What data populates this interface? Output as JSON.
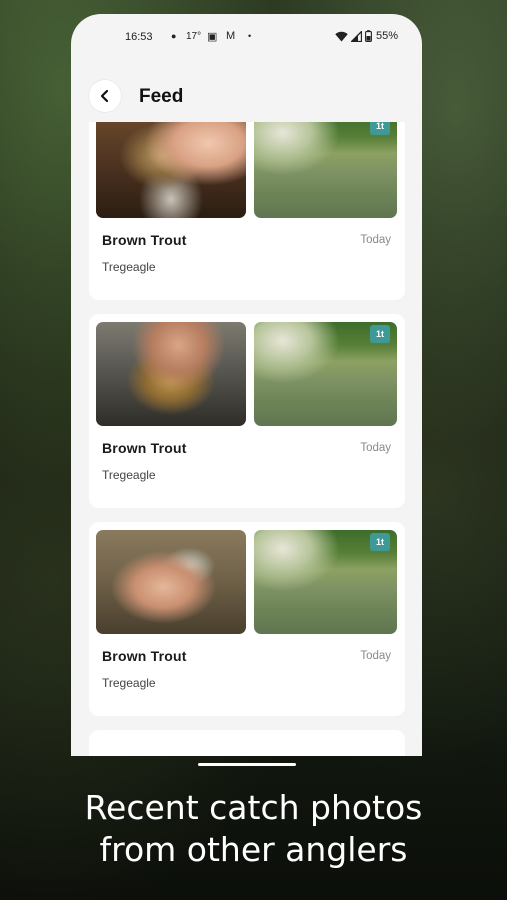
{
  "status_bar": {
    "time": "16:53",
    "temperature": "17°",
    "battery_percent": "55%",
    "icons": [
      "dot-icon",
      "photo-icon",
      "gmail-icon",
      "dot-icon",
      "wifi-icon",
      "signal-icon",
      "battery-icon"
    ]
  },
  "header": {
    "title": "Feed",
    "back_icon": "chevron-left-icon"
  },
  "feed": {
    "items": [
      {
        "species": "Brown Trout",
        "location": "Tregeagle",
        "date": "Today",
        "badge": "1t"
      },
      {
        "species": "Brown Trout",
        "location": "Tregeagle",
        "date": "Today",
        "badge": "1t"
      },
      {
        "species": "Brown Trout",
        "location": "Tregeagle",
        "date": "Today",
        "badge": "1t"
      }
    ]
  },
  "caption": {
    "line1": "Recent catch photos",
    "line2": "from other anglers"
  },
  "colors": {
    "badge": "#3f9a97",
    "screen_background": "#f4f4f4",
    "card_background": "#ffffff"
  }
}
